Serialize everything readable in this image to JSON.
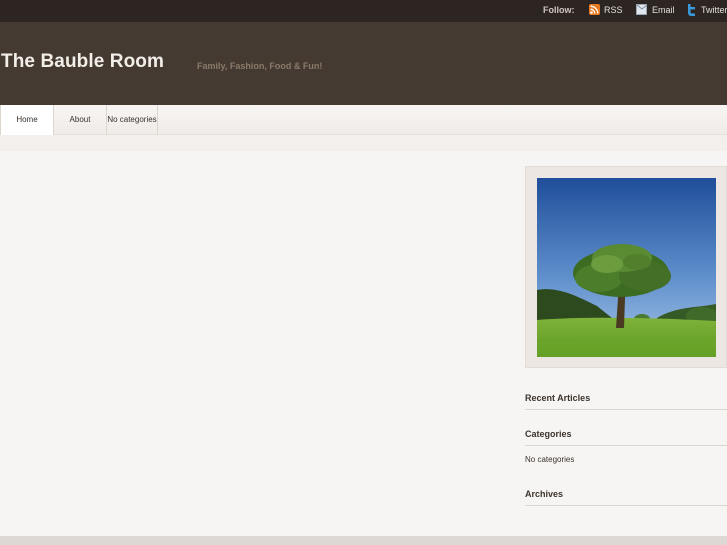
{
  "topbar": {
    "follow_label": "Follow:",
    "rss_label": "RSS",
    "email_label": "Email",
    "twitter_label": "Twitter"
  },
  "header": {
    "site_title": "The Bauble Room",
    "tagline": "Family, Fashion, Food & Fun!"
  },
  "nav": {
    "items": [
      {
        "label": "Home"
      },
      {
        "label": "About"
      },
      {
        "label": "No categories"
      }
    ]
  },
  "sidebar": {
    "recent_title": "Recent Articles",
    "categories_title": "Categories",
    "categories_empty": "No categories",
    "archives_title": "Archives"
  },
  "colors": {
    "header_bg": "#453a31",
    "topbar_bg": "#2c2521",
    "page_bg": "#f7f5f3",
    "rss_orange": "#e8781f",
    "twitter_blue": "#3a9ad9"
  },
  "icons": {
    "rss": "rss-icon",
    "email": "email-icon",
    "twitter": "twitter-icon"
  }
}
